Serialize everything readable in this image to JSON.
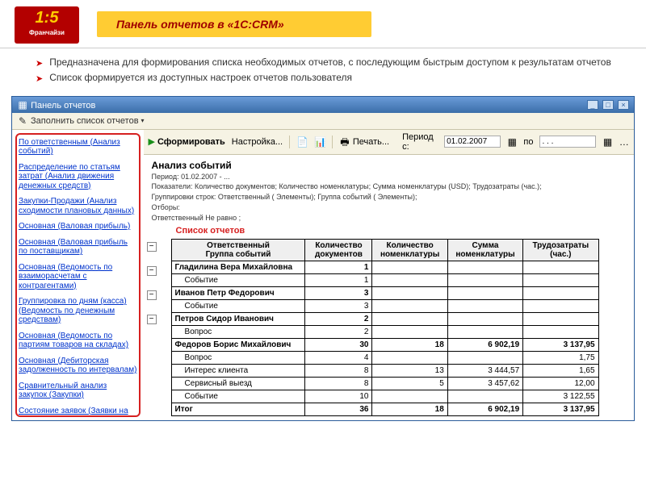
{
  "slide": {
    "logo_main": "1:5",
    "logo_sub": "Франчайзи",
    "title": "Панель отчетов в «1С:CRM»",
    "desc1": "Предназначена для формирования списка необходимых отчетов, с последующим быстрым доступом к результатам отчетов",
    "desc2": "Список формируется из доступных настроек отчетов пользователя"
  },
  "window": {
    "title": "Панель отчетов",
    "fill_btn": "Заполнить список отчетов",
    "form_btn": "Сформировать",
    "settings_btn": "Настройка...",
    "print_btn": "Печать...",
    "period_lbl": "Период с:",
    "period_from": "01.02.2007",
    "period_sep": "по",
    "period_to": ". . ."
  },
  "sidebar": {
    "items": [
      "По ответственным (Анализ событий)",
      "Распределение по статьям затрат (Анализ движения денежных средств)",
      "Закупки-Продажи (Анализ сходимости плановых данных)",
      "Основная (Валовая прибыль)",
      "Основная (Валовая прибыль по поставщикам)",
      "Основная (Ведомость по взаиморасчетам с контрагентами)",
      "Группировка по дням (касса) (Ведомость по денежным средствам)",
      "Основная (Ведомость по партиям товаров на складах)",
      "Основная (Дебиторская задолженность по интервалам)",
      "Сравнительный анализ закупок (Закупки)",
      "Состояние заявок  (Заявки на"
    ]
  },
  "report": {
    "title": "Анализ событий",
    "period": "Период: 01.02.2007 - ...",
    "indicators": "Показатели: Количество документов; Количество номенклатуры; Сумма номенклатуры (USD); Трудозатраты (час.);",
    "groupings": "Группировки строк: Ответственный ( Элементы); Группа событий ( Элементы);",
    "filters_lbl": "Отборы:",
    "filters": "Ответственный Не равно ;",
    "annotation": "Список отчетов",
    "headers": {
      "c0": "Ответственный\nГруппа событий",
      "c1": "Количество документов",
      "c2": "Количество номенклатуры",
      "c3": "Сумма номенклатуры",
      "c4": "Трудозатраты (час.)"
    },
    "rows": [
      {
        "type": "grp",
        "c0": "Гладилина Вера Михайловна",
        "c1": "1",
        "c2": "",
        "c3": "",
        "c4": ""
      },
      {
        "type": "sub",
        "c0": "Событие",
        "c1": "1",
        "c2": "",
        "c3": "",
        "c4": ""
      },
      {
        "type": "grp",
        "c0": "Иванов Петр Федорович",
        "c1": "3",
        "c2": "",
        "c3": "",
        "c4": ""
      },
      {
        "type": "sub",
        "c0": "Событие",
        "c1": "3",
        "c2": "",
        "c3": "",
        "c4": ""
      },
      {
        "type": "grp",
        "c0": "Петров Сидор Иванович",
        "c1": "2",
        "c2": "",
        "c3": "",
        "c4": ""
      },
      {
        "type": "sub",
        "c0": "Вопрос",
        "c1": "2",
        "c2": "",
        "c3": "",
        "c4": ""
      },
      {
        "type": "grp",
        "c0": "Федоров Борис Михайлович",
        "c1": "30",
        "c2": "18",
        "c3": "6 902,19",
        "c4": "3 137,95"
      },
      {
        "type": "sub",
        "c0": "Вопрос",
        "c1": "4",
        "c2": "",
        "c3": "",
        "c4": "1,75"
      },
      {
        "type": "sub",
        "c0": "Интерес клиента",
        "c1": "8",
        "c2": "13",
        "c3": "3 444,57",
        "c4": "1,65"
      },
      {
        "type": "sub",
        "c0": "Сервисный выезд",
        "c1": "8",
        "c2": "5",
        "c3": "3 457,62",
        "c4": "12,00"
      },
      {
        "type": "sub",
        "c0": "Событие",
        "c1": "10",
        "c2": "",
        "c3": "",
        "c4": "3 122,55"
      },
      {
        "type": "tot",
        "c0": "Итог",
        "c1": "36",
        "c2": "18",
        "c3": "6 902,19",
        "c4": "3 137,95"
      }
    ]
  },
  "chart_data": {
    "type": "table",
    "title": "Анализ событий",
    "columns": [
      "Ответственный / Группа событий",
      "Количество документов",
      "Количество номенклатуры",
      "Сумма номенклатуры",
      "Трудозатраты (час.)"
    ],
    "groups": [
      {
        "name": "Гладилина Вера Михайловна",
        "docs": 1,
        "items": null,
        "sum": null,
        "hours": null,
        "children": [
          {
            "name": "Событие",
            "docs": 1
          }
        ]
      },
      {
        "name": "Иванов Петр Федорович",
        "docs": 3,
        "items": null,
        "sum": null,
        "hours": null,
        "children": [
          {
            "name": "Событие",
            "docs": 3
          }
        ]
      },
      {
        "name": "Петров Сидор Иванович",
        "docs": 2,
        "items": null,
        "sum": null,
        "hours": null,
        "children": [
          {
            "name": "Вопрос",
            "docs": 2
          }
        ]
      },
      {
        "name": "Федоров Борис Михайлович",
        "docs": 30,
        "items": 18,
        "sum": 6902.19,
        "hours": 3137.95,
        "children": [
          {
            "name": "Вопрос",
            "docs": 4,
            "hours": 1.75
          },
          {
            "name": "Интерес клиента",
            "docs": 8,
            "items": 13,
            "sum": 3444.57,
            "hours": 1.65
          },
          {
            "name": "Сервисный выезд",
            "docs": 8,
            "items": 5,
            "sum": 3457.62,
            "hours": 12.0
          },
          {
            "name": "Событие",
            "docs": 10,
            "hours": 3122.55
          }
        ]
      }
    ],
    "total": {
      "docs": 36,
      "items": 18,
      "sum": 6902.19,
      "hours": 3137.95
    }
  }
}
